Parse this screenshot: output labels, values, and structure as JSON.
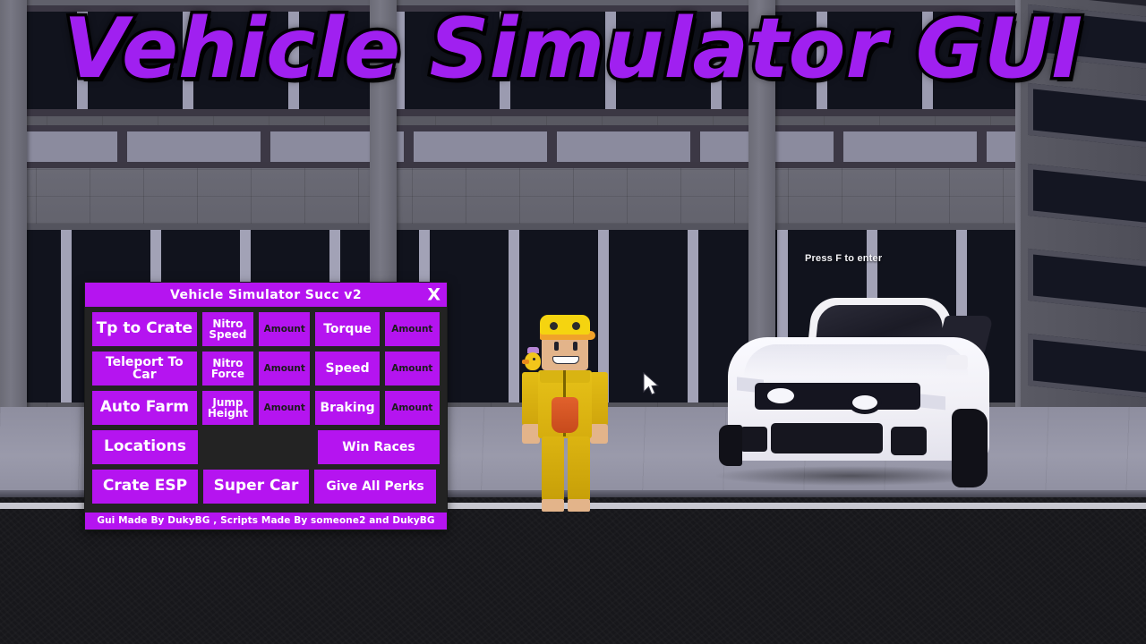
{
  "scene": {
    "game_prompt": "Press F to enter",
    "overlay_title": "Vehicle Simulator GUI"
  },
  "gui": {
    "title": "Vehicle Simulator Succ v2",
    "close_label": "X",
    "footer": "Gui Made By DukyBG , Scripts Made By someone2 and DukyBG",
    "colors": {
      "accent": "#b514f0",
      "panel_bg": "#232323",
      "button_text": "#ffffff",
      "placeholder_text": "#1b1b1b"
    },
    "rows": [
      {
        "left_button": "Tp to Crate",
        "mid_label": "Nitro Speed",
        "mid_input": "Amount",
        "right_label": "Torque",
        "right_input": "Amount"
      },
      {
        "left_button": "Teleport To Car",
        "mid_label": "Nitro Force",
        "mid_input": "Amount",
        "right_label": "Speed",
        "right_input": "Amount"
      },
      {
        "left_button": "Auto Farm",
        "mid_label": "Jump Height",
        "mid_input": "Amount",
        "right_label": "Braking",
        "right_input": "Amount"
      }
    ],
    "row4": {
      "left_button": "Locations",
      "right_button": "Win Races"
    },
    "row5": {
      "left_button": "Crate ESP",
      "mid_button": "Super Car",
      "right_button": "Give All Perks"
    }
  }
}
